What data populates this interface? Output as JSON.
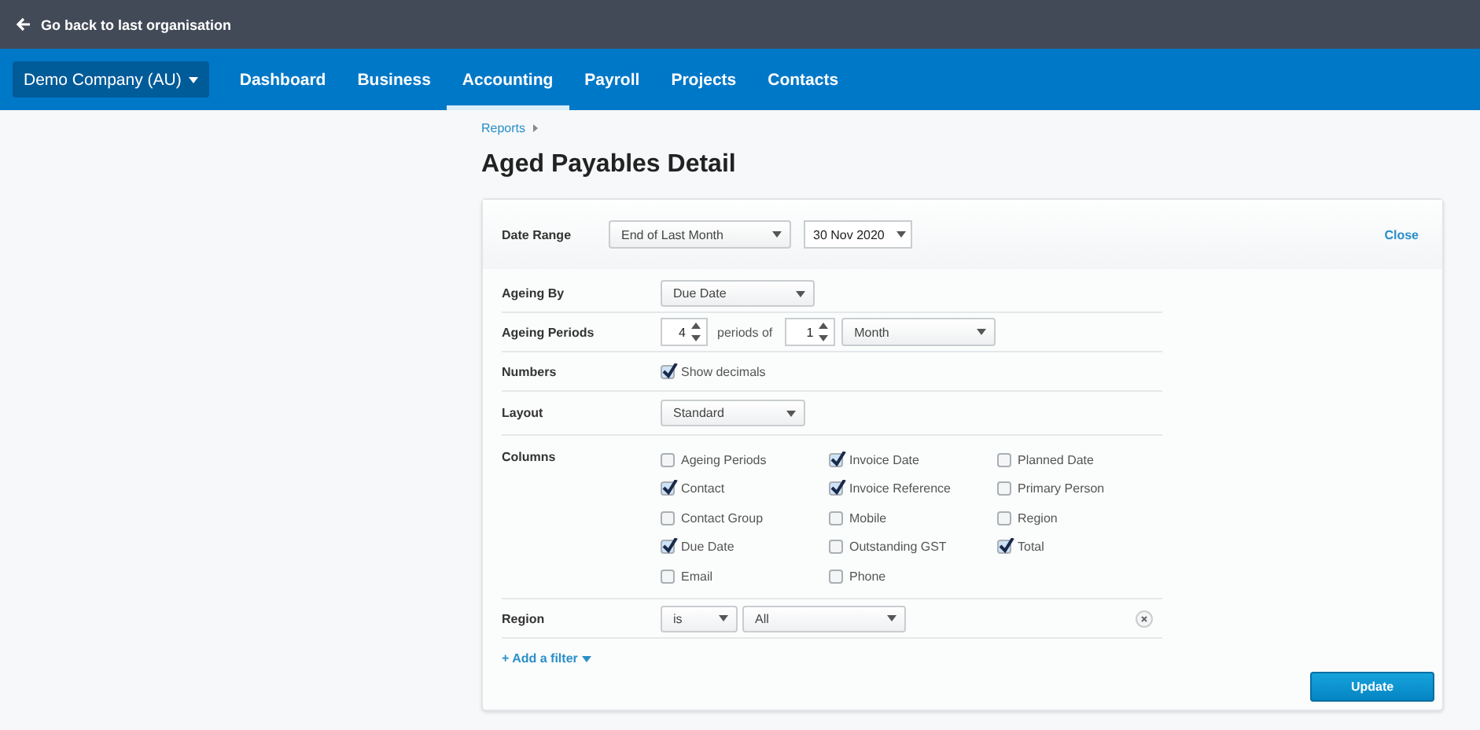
{
  "top_bar": {
    "back_link": "Go back to last organisation"
  },
  "nav": {
    "org": "Demo Company (AU)",
    "items": [
      {
        "label": "Dashboard",
        "selected": false
      },
      {
        "label": "Business",
        "selected": false
      },
      {
        "label": "Accounting",
        "selected": true
      },
      {
        "label": "Payroll",
        "selected": false
      },
      {
        "label": "Projects",
        "selected": false
      },
      {
        "label": "Contacts",
        "selected": false
      }
    ]
  },
  "breadcrumb": [
    "Reports"
  ],
  "title": "Aged Payables Detail",
  "header": {
    "label": "Date Range",
    "range": "End of Last Month",
    "date": "30 Nov 2020",
    "close": "Close"
  },
  "ageing_by": {
    "label": "Ageing By",
    "value": "Due Date"
  },
  "ageing_periods": {
    "label": "Ageing Periods",
    "count": "4",
    "between": "periods of",
    "length": "1",
    "unit": "Month"
  },
  "numbers": {
    "label": "Numbers",
    "option": "Show decimals",
    "checked": true
  },
  "layout": {
    "label": "Layout",
    "value": "Standard"
  },
  "columns": {
    "label": "Columns",
    "options": [
      {
        "label": "Ageing Periods",
        "checked": false
      },
      {
        "label": "Contact",
        "checked": true
      },
      {
        "label": "Contact Group",
        "checked": false
      },
      {
        "label": "Due Date",
        "checked": true
      },
      {
        "label": "Email",
        "checked": false
      },
      {
        "label": "Invoice Date",
        "checked": true
      },
      {
        "label": "Invoice Reference",
        "checked": true
      },
      {
        "label": "Mobile",
        "checked": false
      },
      {
        "label": "Outstanding GST",
        "checked": false
      },
      {
        "label": "Phone",
        "checked": false
      },
      {
        "label": "Planned Date",
        "checked": false
      },
      {
        "label": "Primary Person",
        "checked": false
      },
      {
        "label": "Region",
        "checked": false
      },
      {
        "label": "Total",
        "checked": true
      }
    ]
  },
  "filter": {
    "label": "Region",
    "operator": "is",
    "value": "All"
  },
  "add_filter": "+ Add a filter",
  "update": "Update"
}
